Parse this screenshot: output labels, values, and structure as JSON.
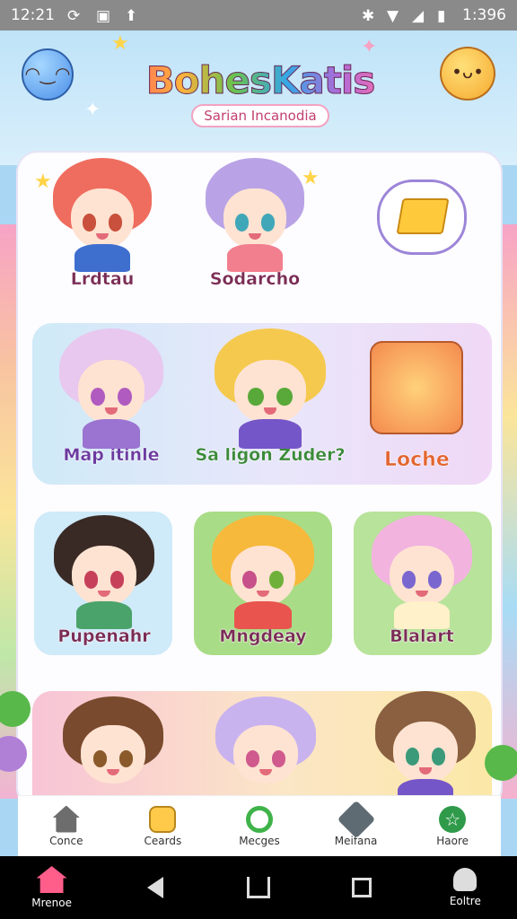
{
  "status_bar": {
    "time_left": "12:21",
    "time_right": "1:396"
  },
  "app": {
    "title": "BohesKatis",
    "subtitle": "Sarian Incanodia"
  },
  "characters": [
    {
      "name": "Lrdtau"
    },
    {
      "name": "Sodarcho"
    },
    {
      "name": "Map itinle"
    },
    {
      "name": "Sa ligon Zuder?"
    },
    {
      "name": "Pupenahr"
    },
    {
      "name": "Mngdeay"
    },
    {
      "name": "Blalart"
    }
  ],
  "featured": {
    "game_label": "Loche"
  },
  "tabs": [
    {
      "label": "Conce"
    },
    {
      "label": "Ceards"
    },
    {
      "label": "Mecges"
    },
    {
      "label": "Meifana"
    },
    {
      "label": "Haore"
    }
  ],
  "nav": {
    "left_label": "Mrenoe",
    "right_label": "Eoltre"
  },
  "colors": {
    "accent": "#ff5d8a",
    "sky": "#bfe3f8"
  }
}
